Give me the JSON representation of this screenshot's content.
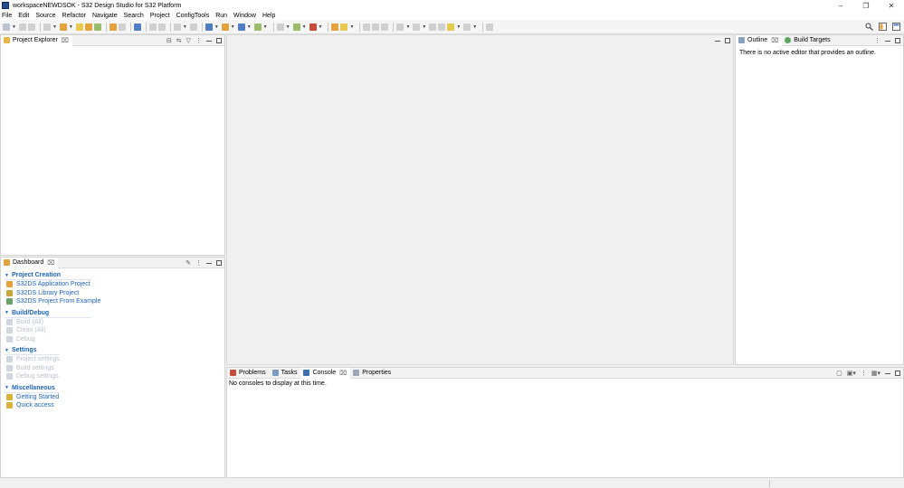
{
  "window": {
    "title": "workspaceNEWDSOK - S32 Design Studio for S32 Platform"
  },
  "menu": [
    "File",
    "Edit",
    "Source",
    "Refactor",
    "Navigate",
    "Search",
    "Project",
    "ConfigTools",
    "Run",
    "Window",
    "Help"
  ],
  "project_explorer": {
    "tab": "Project Explorer"
  },
  "dashboard": {
    "tab": "Dashboard",
    "sections": [
      {
        "title": "Project Creation",
        "items": [
          {
            "label": "S32DS Application Project",
            "icon": "new-app-icon"
          },
          {
            "label": "S32DS Library Project",
            "icon": "library-icon"
          },
          {
            "label": "S32DS Project From Example",
            "icon": "example-icon"
          }
        ]
      },
      {
        "title": "Build/Debug",
        "items": [
          {
            "label": "Build  (All)",
            "icon": "hammer-icon"
          },
          {
            "label": "Clean  (All)",
            "icon": "broom-icon"
          },
          {
            "label": "Debug",
            "icon": "bug-icon"
          }
        ]
      },
      {
        "title": "Settings",
        "items": [
          {
            "label": "Project settings",
            "icon": "settings-icon"
          },
          {
            "label": "Build settings",
            "icon": "settings-icon"
          },
          {
            "label": "Debug settings",
            "icon": "settings-icon"
          }
        ]
      },
      {
        "title": "Miscellaneous",
        "items": [
          {
            "label": "Getting Started",
            "icon": "getting-started-icon"
          },
          {
            "label": "Quick access",
            "icon": "quick-access-icon"
          }
        ]
      }
    ]
  },
  "outline": {
    "tabs": [
      "Outline",
      "Build Targets"
    ],
    "message": "There is no active editor that provides an outline."
  },
  "console": {
    "tabs": [
      "Problems",
      "Tasks",
      "Console",
      "Properties"
    ],
    "message": "No consoles to display at this time."
  }
}
